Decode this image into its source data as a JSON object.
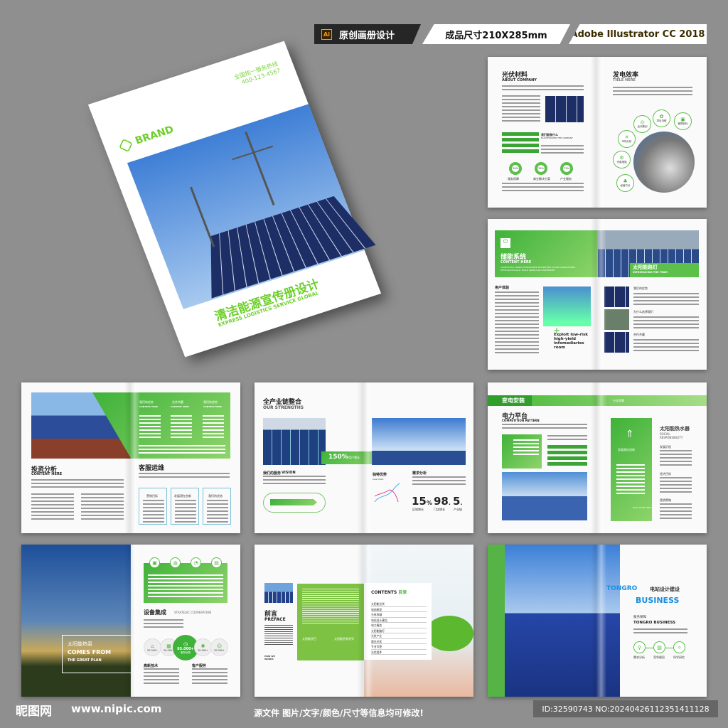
{
  "tags": {
    "software_badge": "Ai",
    "original_label": "原创画册设计",
    "size_label": "成品尺寸210X285mm",
    "software_label": "Adobe Illustrator CC 2018"
  },
  "cover": {
    "brand": "BRAND",
    "hotline_label": "全国统一服务热线",
    "hotline": "400-123-4567",
    "title": "清洁能源宣传册设计",
    "subtitle": "EXPRESS LOGISTICS SERVICE GLOBAL"
  },
  "spread1": {
    "left_title": "光伏材料",
    "left_sub": "ABOUT COMPANY",
    "caption": "我们能做什么",
    "caption_sub": "PLACEHOLDER THE COMPANY",
    "rings": [
      {
        "value": "30%",
        "label": "服务保障"
      },
      {
        "value": "35%",
        "label": "商业解决方案"
      },
      {
        "value": "75%",
        "label": "产业服务"
      }
    ],
    "right_title": "发电效率",
    "right_sub": "TIELE HERE",
    "nodes": [
      "活动策划",
      "项目流程",
      "管理目标",
      "市场分析",
      "完善措施",
      "经营方针"
    ]
  },
  "spread2": {
    "title": "储能系统",
    "sub": "CONTENT HERE",
    "desc": "COMPLETELY MORPH EMPOWERED ROI BEFORE 24/365 APPLICATIONS ENTHUSIASTICALLY BUILD GRANULAR LEADERSHIP",
    "banner_title": "太阳能路灯",
    "banner_sub": "INTRODUCING THE TEAM",
    "section": "用户体验",
    "quote": "Exploit low-risk high-yield infomediaries room",
    "items": [
      "我们的优势",
      "为什么选择我们",
      "合作共赢"
    ]
  },
  "spread3": {
    "cols": [
      {
        "title": "我们的优势",
        "sub": "CONTENT HERE"
      },
      {
        "title": "合作共赢",
        "sub": "CONTENT HERE"
      },
      {
        "title": "我们的优势",
        "sub": "CONTENT HERE"
      }
    ],
    "left_title": "投资分析",
    "left_sub": "CONTENT HERE",
    "right_title": "客服运维",
    "cards": [
      "营销目标",
      "发展潜在创新",
      "我们的优势"
    ]
  },
  "spread4": {
    "title": "全产业链整合",
    "sub": "OUR STRENGTHS",
    "stat_banner": "150%",
    "stat_banner_label": "用户增长",
    "vision": "我们的服务",
    "vision_en": "VISION",
    "chart_title": "独特优势",
    "chart_sub": "Line Chart",
    "right_head": "需求分析",
    "stats": [
      {
        "value": "15",
        "unit": "%",
        "label": "区域增长"
      },
      {
        "value": "98",
        "unit": ".",
        "label": "门店增长"
      },
      {
        "value": "5",
        "unit": ".",
        "label": "产业链"
      }
    ]
  },
  "spread5": {
    "band": "变电安装",
    "band_right": "行业背景",
    "title": "电力平台",
    "sub": "COMPETITION PATTERN",
    "card_label": "发展源自创新",
    "card_foot": "OUR VALUE THE COMPANY",
    "right_title": "太阳能热水器",
    "right_sub": "SOCIAL RESPONSIBILITY",
    "sections": [
      "发展历程",
      "经济目标",
      "营销策略"
    ]
  },
  "spread6": {
    "overlay_cn": "太阳能热泵",
    "overlay_en1": "COMES FROM",
    "overlay_en2": "THE GREAT PLAN",
    "title": "设备集成",
    "title_en": "STRATEGIC COOPERATION",
    "center_value": "85.000+",
    "center_label": "服务优势",
    "small_values": [
      "30.000+",
      "30.000+",
      "30.000+",
      "30.000+"
    ],
    "left_head": "高新技术",
    "right_head": "客户服务"
  },
  "spread7": {
    "title": "前言",
    "sub": "PREFACE",
    "foot": "HOW WE WORKS",
    "green_items": [
      "太阳能项目",
      "太阳能热泵系列"
    ],
    "contents_title": "CONTENTS",
    "contents_cn": "目录",
    "toc": [
      "太阳能光伏",
      "电站研发",
      "光电领域",
      "电站设计建设",
      "电力服务",
      "太阳能路灯",
      "光伏产业",
      "整光光伏",
      "专业可靠",
      "光伏组件"
    ]
  },
  "spread8": {
    "brand1": "TONGRO",
    "title_cn": "电站设计建设",
    "brand2": "BUSINESS",
    "sub_cn": "服务保障",
    "sub_en": "TONGRO BUSINESS",
    "icons": [
      "需求分析",
      "竞争格局",
      "科学研究"
    ]
  },
  "footer": {
    "logo": "昵图网",
    "site": "www.nipic.com",
    "note": "源文件 图片/文字/颜色/尺寸等信息均可修改!",
    "id": "ID:32590743 NO:20240426112351411128"
  },
  "colors": {
    "accent": "#4cb83c",
    "background": "#8f8f8f",
    "blue": "#1a8fe0"
  }
}
